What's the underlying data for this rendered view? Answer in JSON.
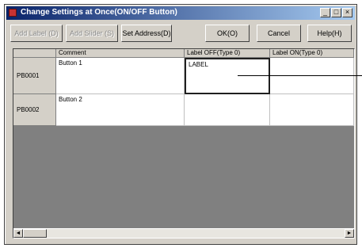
{
  "window": {
    "title": "Change Settings at Once(ON/OFF Button)",
    "controls": {
      "minimize": "_",
      "maximize": "□",
      "close": "×"
    }
  },
  "toolbar": {
    "disabled_1": "Add Label (D)",
    "disabled_2": "Add Slider (S)",
    "set_address": "Set Address(D)",
    "ok": "OK(O)",
    "cancel": "Cancel",
    "help": "Help(H)"
  },
  "table": {
    "columns": [
      "Comment",
      "Label OFF(Type 0)",
      "Label ON(Type 0)"
    ],
    "rows": [
      {
        "id": "PB0001",
        "comment": "Button 1",
        "label_off": "LABEL",
        "label_on": ""
      },
      {
        "id": "PB0002",
        "comment": "Button 2",
        "label_off": "",
        "label_on": ""
      }
    ]
  },
  "scrollbar": {
    "left_arrow": "◄",
    "right_arrow": "►"
  }
}
